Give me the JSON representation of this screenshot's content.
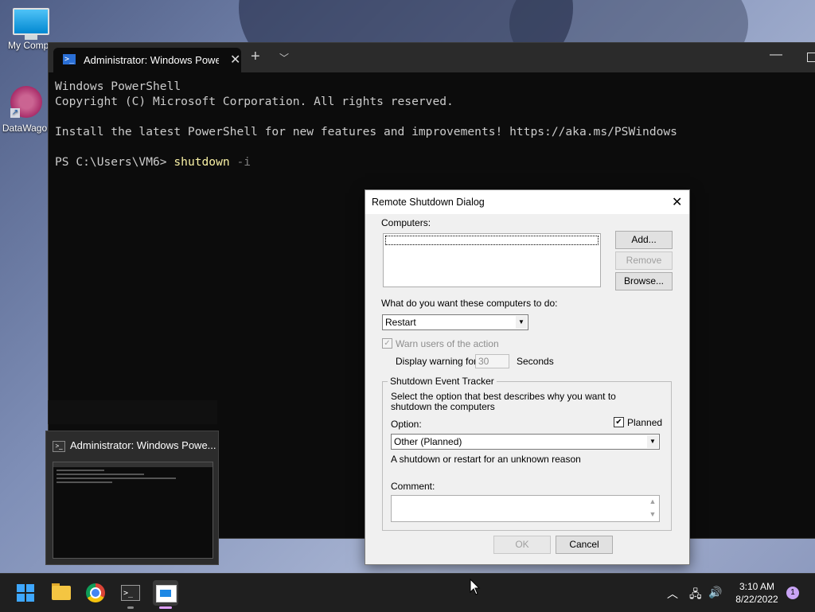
{
  "desktop": {
    "icons": [
      {
        "label": "My Compu"
      },
      {
        "label": "DataWagor"
      }
    ]
  },
  "terminal": {
    "tab_title": "Administrator: Windows PowerS",
    "lines": [
      "Windows PowerShell",
      "Copyright (C) Microsoft Corporation. All rights reserved.",
      "",
      "Install the latest PowerShell for new features and improvements! https://aka.ms/PSWindows",
      ""
    ],
    "prompt": "PS C:\\Users\\VM6> ",
    "command": "shutdown",
    "argument": " -i"
  },
  "preview": {
    "title": "Administrator: Windows Powe..."
  },
  "dialog": {
    "title": "Remote Shutdown Dialog",
    "computers_label": "Computers:",
    "add_button": "Add...",
    "remove_button": "Remove",
    "browse_button": "Browse...",
    "action_label": "What do you want these computers to do:",
    "action_value": "Restart",
    "warn_label": "Warn users of the action",
    "display_warning_label": "Display warning for",
    "warning_seconds": "30",
    "seconds_label": "Seconds",
    "tracker_title": "Shutdown Event Tracker",
    "tracker_desc": "Select the option that best describes why you want to shutdown the computers",
    "option_label": "Option:",
    "planned_label": "Planned",
    "option_value": "Other (Planned)",
    "reason_text": "A shutdown or restart for an unknown reason",
    "comment_label": "Comment:",
    "ok_button": "OK",
    "cancel_button": "Cancel"
  },
  "taskbar": {
    "time": "3:10 AM",
    "date": "8/22/2022",
    "notification_count": "1"
  }
}
